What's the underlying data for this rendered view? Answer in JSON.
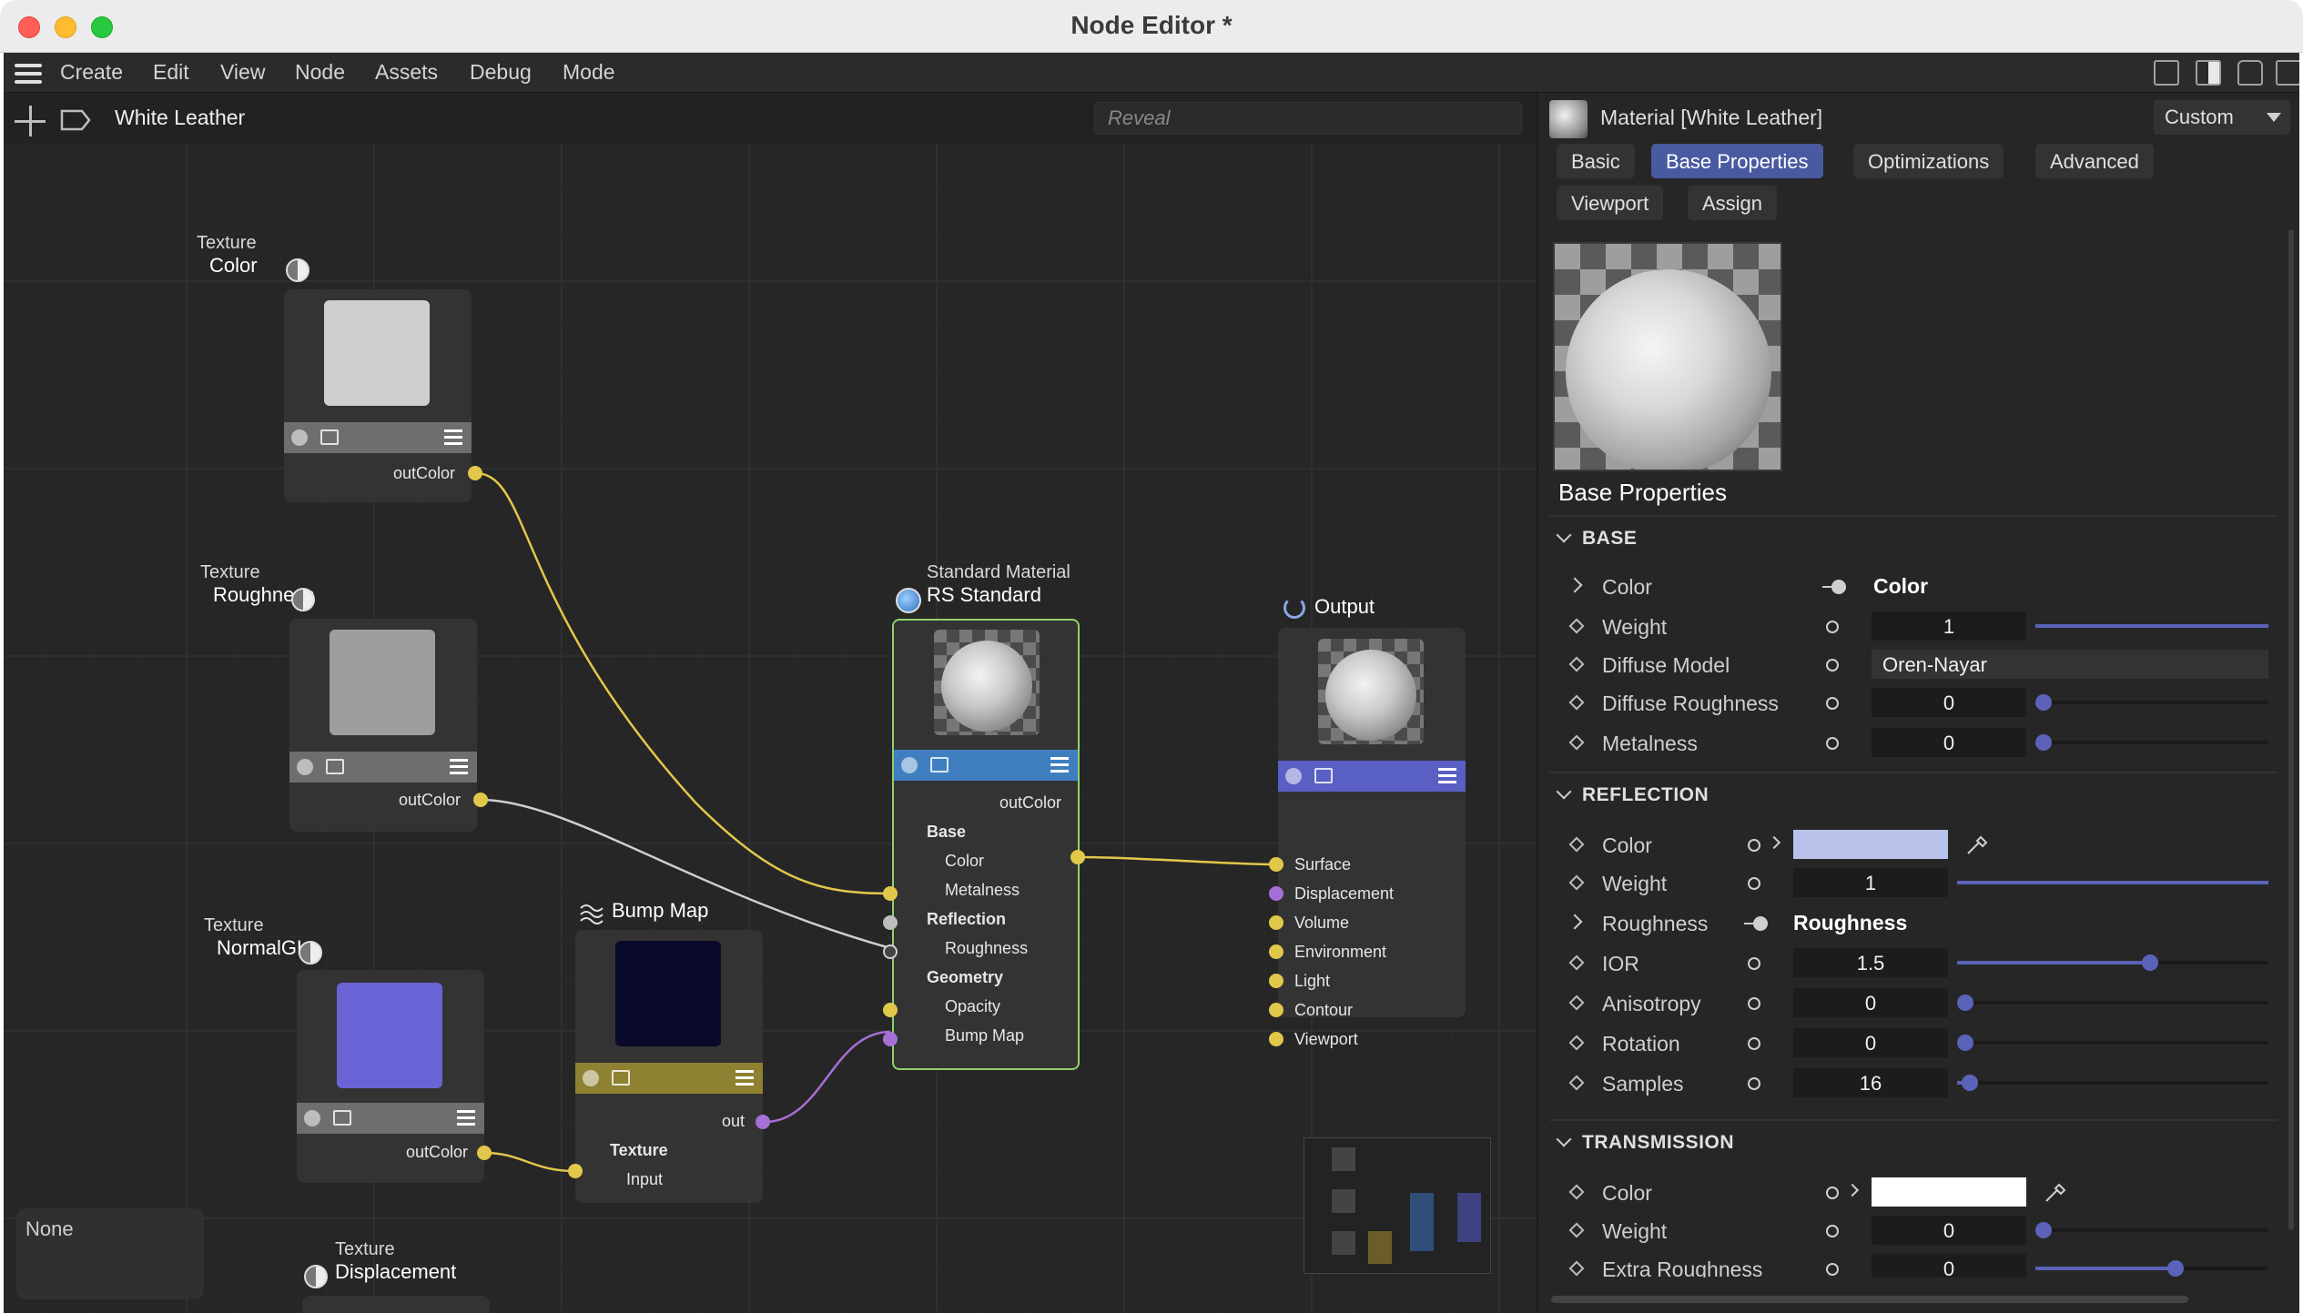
{
  "window": {
    "title": "Node Editor *"
  },
  "menu": [
    "Create",
    "Edit",
    "View",
    "Node",
    "Assets",
    "Debug",
    "Mode"
  ],
  "editor": {
    "breadcrumb": "White Leather",
    "reveal_placeholder": "Reveal",
    "nodes": {
      "tex_color": {
        "type": "Texture",
        "name": "Color",
        "port": "outColor",
        "swatch": "#cfcfcf",
        "bar": "#6e6e6e"
      },
      "tex_rough": {
        "type": "Texture",
        "name": "Roughness",
        "port": "outColor",
        "swatch": "#9e9e9e",
        "bar": "#6e6e6e"
      },
      "tex_normal": {
        "type": "Texture",
        "name": "NormalGL",
        "port": "outColor",
        "swatch": "#6a63d6",
        "bar": "#6e6e6e"
      },
      "tex_disp": {
        "type": "Texture",
        "name": "Displacement"
      },
      "bump": {
        "name": "Bump Map",
        "port_out": "out",
        "section": "Texture",
        "input": "Input",
        "swatch": "#0a0a2a",
        "bar": "#8e8132"
      },
      "standard": {
        "type": "Standard Material",
        "name": "RS Standard",
        "port_out": "outColor",
        "sections": [
          {
            "title": "Base",
            "ports": [
              "Color",
              "Metalness"
            ]
          },
          {
            "title": "Reflection",
            "ports": [
              "Roughness"
            ]
          },
          {
            "title": "Geometry",
            "ports": [
              "Opacity",
              "Bump Map"
            ]
          }
        ],
        "bar": "#3f7fbf"
      },
      "output": {
        "name": "Output",
        "ports": [
          "Surface",
          "Displacement",
          "Volume",
          "Environment",
          "Light",
          "Contour",
          "Viewport"
        ],
        "bar": "#5a5fc4"
      }
    },
    "none_box": "None"
  },
  "panel": {
    "material_title": "Material [White Leather]",
    "preset": "Custom",
    "tabs": [
      "Basic",
      "Base Properties",
      "Optimizations",
      "Advanced",
      "Viewport",
      "Assign"
    ],
    "active_tab": "Base Properties",
    "heading": "Base Properties",
    "base": {
      "title": "BASE",
      "color_label": "Color",
      "color_link": "Color",
      "weight_label": "Weight",
      "weight": "1",
      "weight_frac": 1.0,
      "diffuse_model_label": "Diffuse Model",
      "diffuse_model": "Oren-Nayar",
      "diffuse_rough_label": "Diffuse Roughness",
      "diffuse_rough": "0",
      "diffuse_rough_frac": 0.0,
      "metalness_label": "Metalness",
      "metalness": "0",
      "metalness_frac": 0.0
    },
    "reflection": {
      "title": "REFLECTION",
      "color_label": "Color",
      "color": "#b8c2ea",
      "weight_label": "Weight",
      "weight": "1",
      "weight_frac": 1.0,
      "roughness_label": "Roughness",
      "roughness_link": "Roughness",
      "ior_label": "IOR",
      "ior": "1.5",
      "ior_frac": 0.62,
      "aniso_label": "Anisotropy",
      "aniso": "0",
      "aniso_frac": 0.0,
      "rotation_label": "Rotation",
      "rotation": "0",
      "rotation_frac": 0.0,
      "samples_label": "Samples",
      "samples": "16",
      "samples_frac": 0.04
    },
    "transmission": {
      "title": "TRANSMISSION",
      "color_label": "Color",
      "color": "#ffffff",
      "weight_label": "Weight",
      "weight": "0",
      "weight_frac": 0.0,
      "extra_rough_label": "Extra Roughness",
      "extra_rough": "0",
      "extra_rough_frac": 0.6
    }
  }
}
